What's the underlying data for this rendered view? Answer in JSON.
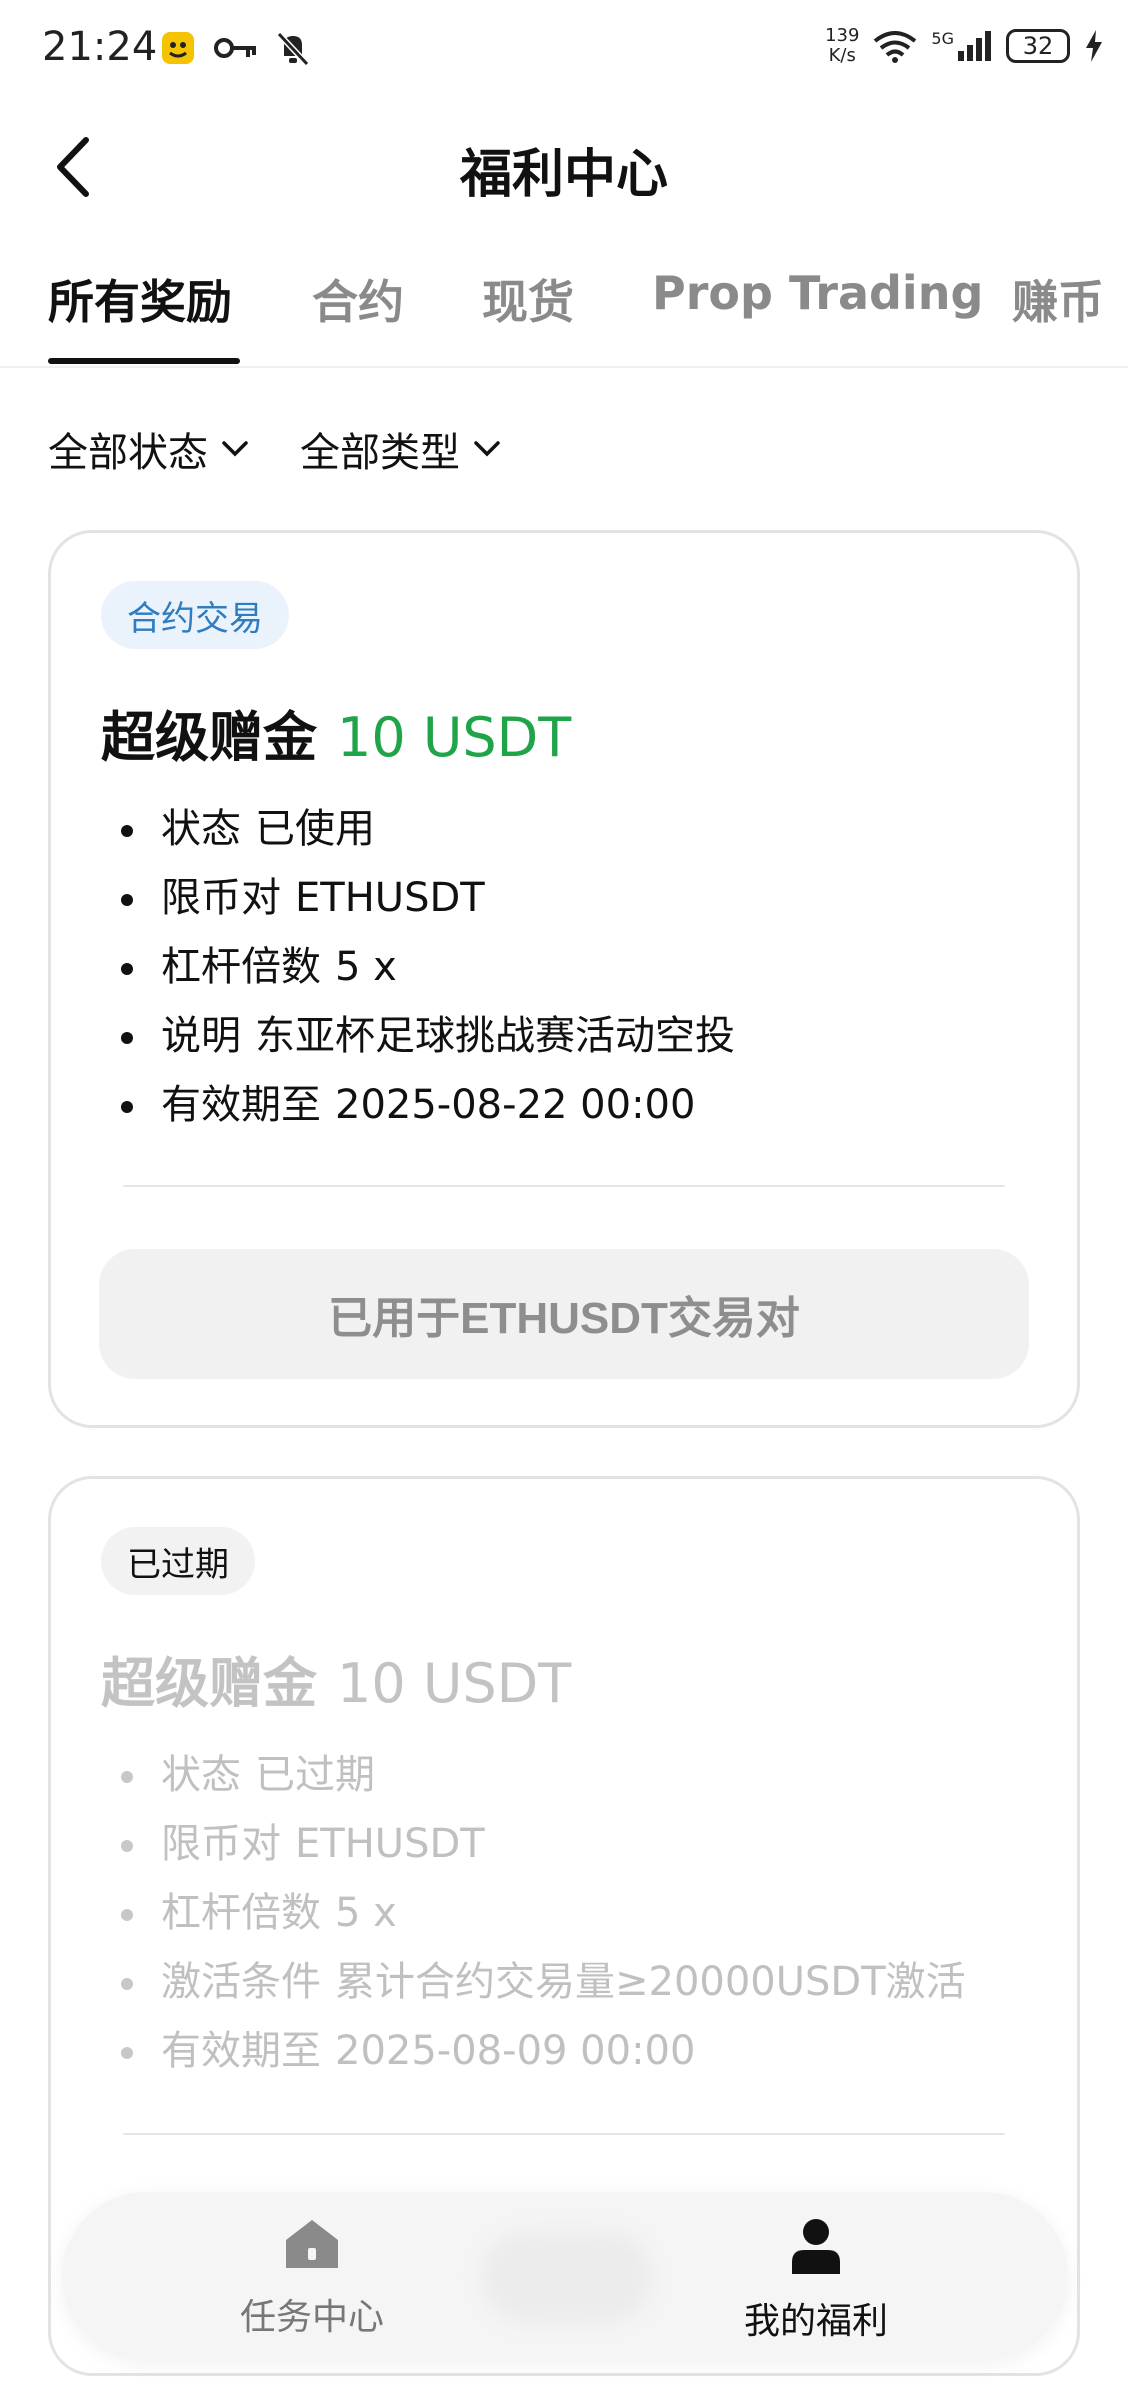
{
  "status_bar": {
    "time": "21:24",
    "speed_value": "139",
    "speed_unit": "K/s",
    "network": "5G",
    "battery": "32",
    "icons": [
      "app-emoji-icon",
      "key-icon",
      "bell-off-icon",
      "wifi-icon",
      "signal-icon",
      "charging-icon"
    ]
  },
  "header": {
    "title": "福利中心"
  },
  "tabs": [
    {
      "label": "所有奖励",
      "active": true
    },
    {
      "label": "合约"
    },
    {
      "label": "现货"
    },
    {
      "label": "Prop Trading"
    },
    {
      "label": "赚币"
    }
  ],
  "filters": [
    {
      "label": "全部状态"
    },
    {
      "label": "全部类型"
    }
  ],
  "cards": [
    {
      "badge": "合约交易",
      "title": "超级赠金",
      "amount": "10 USDT",
      "items": [
        {
          "k": "状态",
          "v": "已使用"
        },
        {
          "k": "限币对",
          "v": "ETHUSDT"
        },
        {
          "k": "杠杆倍数",
          "v": "5 x"
        },
        {
          "k": "说明",
          "v": "东亚杯足球挑战赛活动空投"
        },
        {
          "k": "有效期至",
          "v": "2025-08-22 00:00"
        }
      ],
      "button": "已用于ETHUSDT交易对"
    },
    {
      "badge": "已过期",
      "title": "超级赠金",
      "amount": "10 USDT",
      "items": [
        {
          "k": "状态",
          "v": "已过期"
        },
        {
          "k": "限币对",
          "v": "ETHUSDT"
        },
        {
          "k": "杠杆倍数",
          "v": "5 x"
        },
        {
          "k": "激活条件",
          "v": "累计合约交易量≥20000USDT激活"
        },
        {
          "k": "有效期至",
          "v": "2025-08-09 00:00"
        }
      ]
    }
  ],
  "bottom_nav": [
    {
      "label": "任务中心",
      "icon": "home-icon"
    },
    {
      "label": "我的福利",
      "icon": "user-icon",
      "active": true
    }
  ],
  "colors": {
    "accent_green": "#1fa44a",
    "badge_blue_text": "#2f7cc0",
    "badge_blue_bg": "#eaf3fb",
    "muted": "#c0c0c0"
  }
}
